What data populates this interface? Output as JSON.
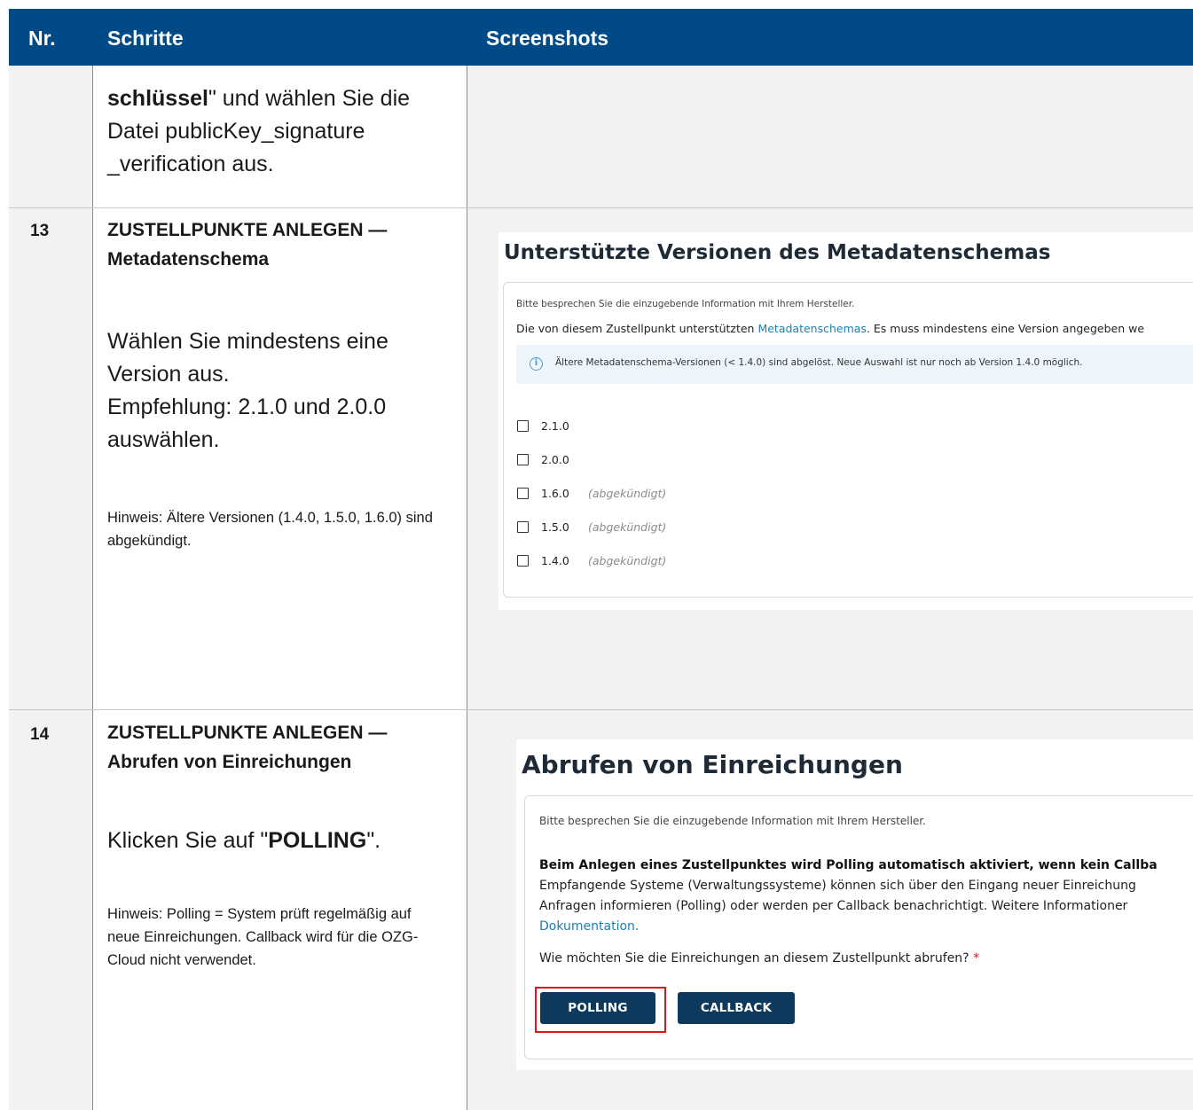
{
  "header": {
    "nr": "Nr.",
    "steps": "Schritte",
    "screenshots": "Screenshots"
  },
  "row_cont": {
    "line_1_bold": "schlüssel",
    "line_1_rest": "\" und wählen Sie die",
    "line_2": "Datei publicKey_signature",
    "line_3": "_verification aus."
  },
  "row_13": {
    "nr": "13",
    "title_line_1": "ZUSTELLPUNKTE ANLEGEN —",
    "title_line_2": "Metadatenschema",
    "text": "Wählen Sie mindestens eine Version aus.",
    "text_2": "Empfehlung: 2.1.0 und 2.0.0 auswählen.",
    "hint": "Hinweis: Ältere Versionen (1.4.0, 1.5.0, 1.6.0) sind abgekündigt.",
    "screenshot": {
      "title": "Unterstützte Versionen des Metadatenschemas",
      "intro": "Bitte besprechen Sie die einzugebende Information mit Ihrem Hersteller.",
      "desc_pre": "Die von diesem Zustellpunkt unterstützten ",
      "desc_link": "Metadatenschemas",
      "desc_post": ". Es muss mindestens eine Version angegeben we",
      "info": "Ältere Metadatenschema-Versionen (< 1.4.0) sind abgelöst. Neue Auswahl ist nur noch ab Version 1.4.0 möglich.",
      "versions": [
        {
          "label": "2.1.0",
          "note": ""
        },
        {
          "label": "2.0.0",
          "note": ""
        },
        {
          "label": "1.6.0",
          "note": "(abgekündigt)"
        },
        {
          "label": "1.5.0",
          "note": "(abgekündigt)"
        },
        {
          "label": "1.4.0",
          "note": "(abgekündigt)"
        }
      ]
    }
  },
  "row_14": {
    "nr": "14",
    "title_line_1": "ZUSTELLPUNKTE ANLEGEN —",
    "title_line_2": "Abrufen von Einreichungen",
    "text_pre": "Klicken Sie auf \"",
    "text_bold": "POLLING",
    "text_post": "\".",
    "hint": "Hinweis: Polling = System prüft regelmäßig auf neue Einreichungen. Callback wird für die OZG-Cloud nicht verwendet.",
    "screenshot": {
      "title": "Abrufen von Einreichungen",
      "intro": "Bitte besprechen Sie die einzugebende Information mit Ihrem Hersteller.",
      "bold_line": "Beim Anlegen eines Zustellpunktes wird Polling automatisch aktiviert, wenn kein Callba",
      "line_2": "Empfangende Systeme (Verwaltungssysteme) können sich über den Eingang neuer Einreichung",
      "line_3": "Anfragen informieren (Polling) oder werden per Callback benachrichtigt. Weitere Informationer",
      "link": "Dokumentation.",
      "question": "Wie möchten Sie die Einreichungen an diesem Zustellpunkt abrufen?",
      "required": "*",
      "btn_polling": "POLLING",
      "btn_callback": "CALLBACK"
    }
  }
}
